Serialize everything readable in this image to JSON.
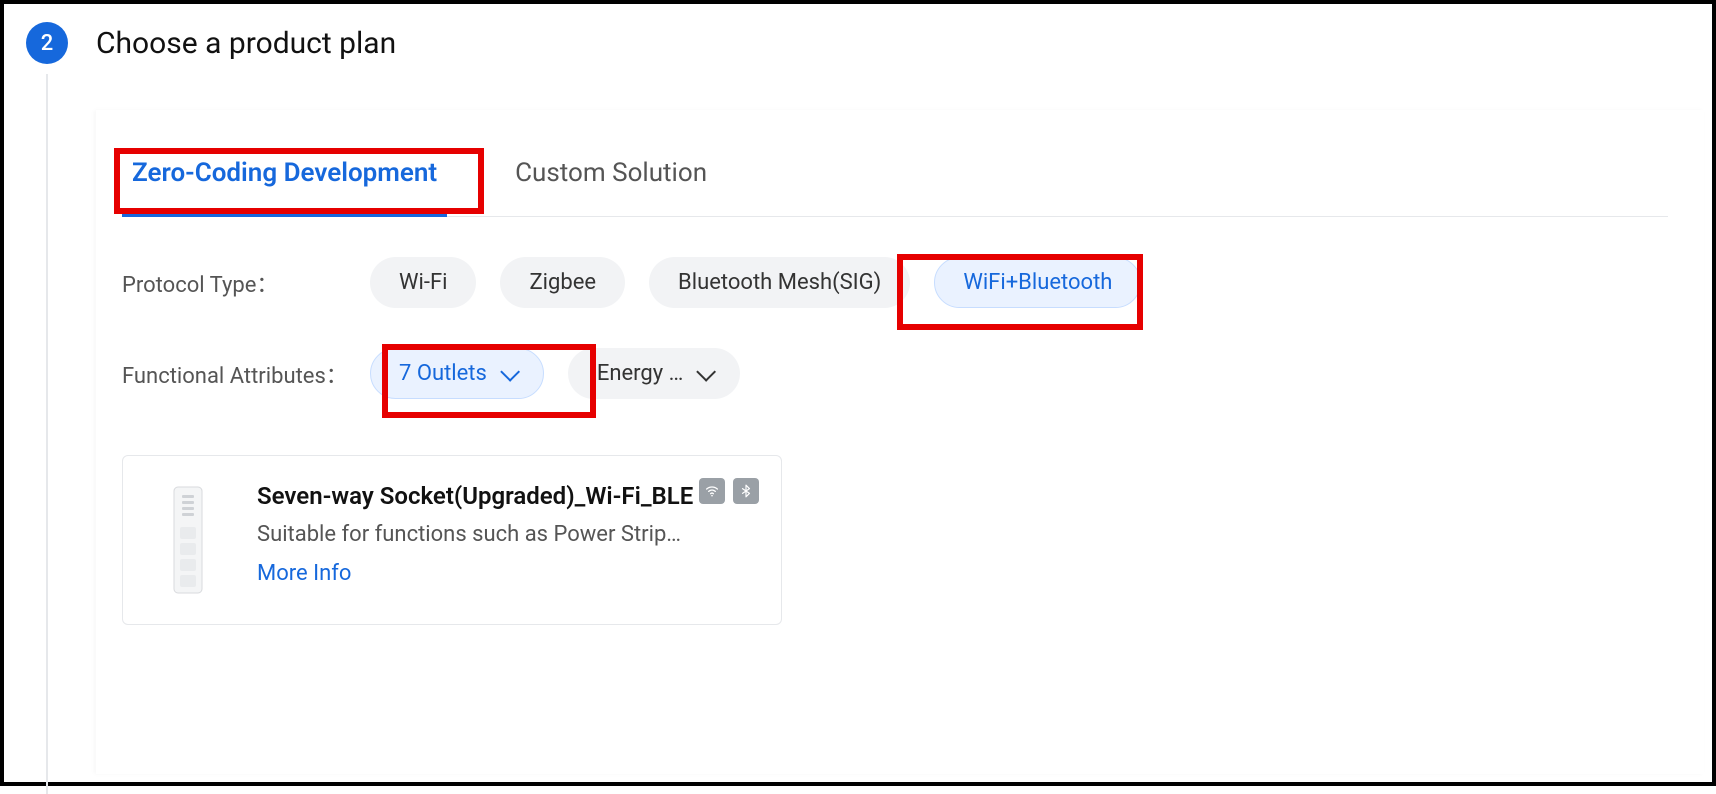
{
  "step": {
    "number": "2",
    "title": "Choose a product plan"
  },
  "tabs": {
    "zero_coding": "Zero-Coding Development",
    "custom": "Custom Solution"
  },
  "filters": {
    "protocol_label": "Protocol Type：",
    "protocols": {
      "wifi": "Wi-Fi",
      "zigbee": "Zigbee",
      "btmesh": "Bluetooth Mesh(SIG)",
      "wifi_bt": "WiFi+Bluetooth"
    },
    "attributes_label": "Functional Attributes：",
    "attributes": {
      "outlets": "7 Outlets",
      "energy": "Energy …"
    }
  },
  "card": {
    "title": "Seven-way Socket(Upgraded)_Wi-Fi_BLE",
    "desc": "Suitable for functions such as Power Strip…",
    "more": "More Info"
  }
}
